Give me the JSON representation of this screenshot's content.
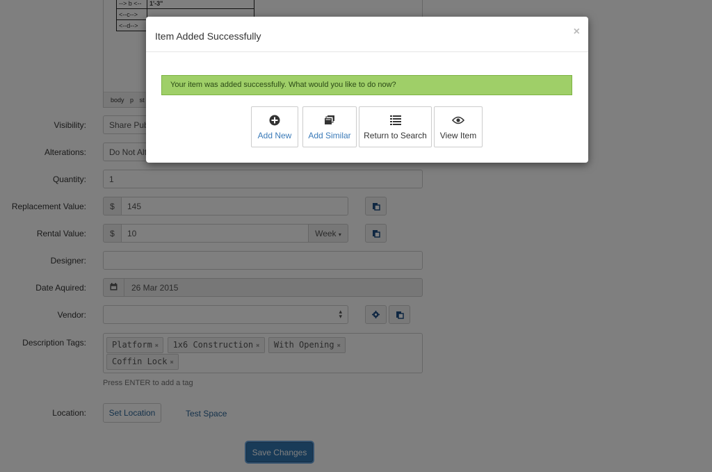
{
  "editor": {
    "table_rows": [
      {
        "label": "--> b <--",
        "value": "1'-3\""
      },
      {
        "label": "<--c-->",
        "value": ""
      },
      {
        "label": "<--d-->",
        "value": ""
      }
    ],
    "path": [
      "body",
      "p",
      "st"
    ]
  },
  "form": {
    "visibility": {
      "label": "Visibility:",
      "value": "Share Publ"
    },
    "alterations": {
      "label": "Alterations:",
      "value": "Do Not Alte"
    },
    "quantity": {
      "label": "Quantity:",
      "value": "1"
    },
    "replacement": {
      "label": "Replacement Value:",
      "currency": "$",
      "value": "145"
    },
    "rental": {
      "label": "Rental Value:",
      "currency": "$",
      "value": "10",
      "period": "Week"
    },
    "designer": {
      "label": "Designer:",
      "value": ""
    },
    "date": {
      "label": "Date Aquired:",
      "value": "26 Mar 2015"
    },
    "vendor": {
      "label": "Vendor:",
      "value": ""
    },
    "tags": {
      "label": "Description Tags:",
      "items": [
        "Platform",
        "1x6 Construction",
        "With Opening",
        "Coffin Lock"
      ],
      "help": "Press ENTER to add a tag"
    },
    "location": {
      "label": "Location:",
      "button": "Set Location",
      "link": "Test Space"
    },
    "save": "Save Changes"
  },
  "modal": {
    "title": "Item Added Successfully",
    "close": "×",
    "message": "Your item was added successfully. What would you like to do now?",
    "actions": [
      {
        "label": "Add New",
        "icon": "plus-circle-icon"
      },
      {
        "label": "Add Similar",
        "icon": "copy-stack-icon"
      },
      {
        "label": "Return to Search",
        "icon": "list-icon"
      },
      {
        "label": "View Item",
        "icon": "eye-icon"
      }
    ]
  },
  "colors": {
    "success_bg": "#9fcf68",
    "primary": "#3276b1",
    "link": "#2a6496"
  }
}
